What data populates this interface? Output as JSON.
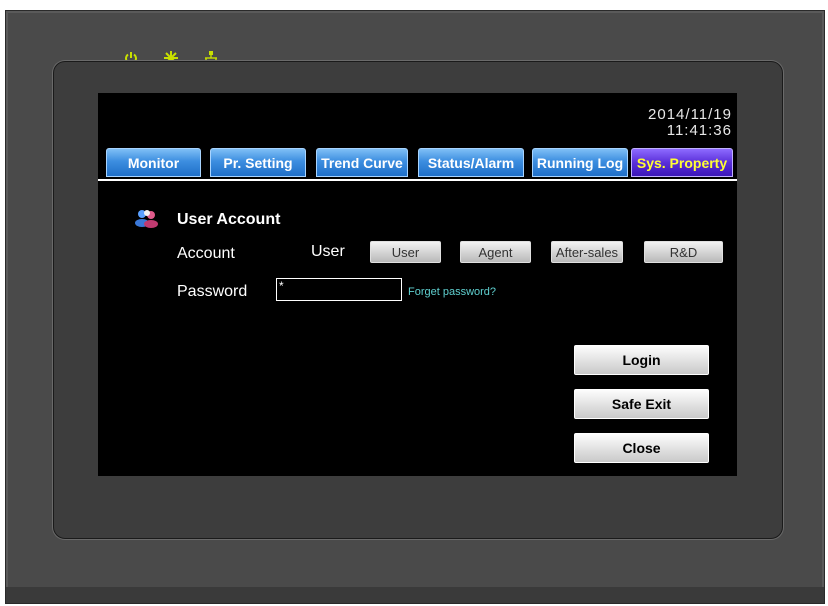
{
  "device": {
    "leds": [
      {
        "icon": "power-icon",
        "color": "#c8e000"
      },
      {
        "icon": "sun-icon",
        "color": "#c8e000"
      },
      {
        "icon": "network-icon",
        "color": "#c8e000"
      }
    ]
  },
  "screen": {
    "date": "2014/11/19",
    "time": "11:41:36"
  },
  "tabs": [
    {
      "label": "Monitor",
      "active": false
    },
    {
      "label": "Pr. Setting",
      "active": false
    },
    {
      "label": "Trend Curve",
      "active": false
    },
    {
      "label": "Status/Alarm",
      "active": false
    },
    {
      "label": "Running Log",
      "active": false
    },
    {
      "label": "Sys. Property",
      "active": true
    }
  ],
  "user_account": {
    "title": "User Account",
    "icon": "users-icon",
    "account_label": "Account",
    "current_user": "User",
    "roles": [
      "User",
      "Agent",
      "After-sales",
      "R&D"
    ],
    "password_label": "Password",
    "password_value": "*",
    "forget_password": "Forget password?"
  },
  "actions": {
    "login": "Login",
    "safe_exit": "Safe Exit",
    "close": "Close"
  },
  "colors": {
    "tab_blue": "#3d8ee0",
    "tab_active": "#5a2fd9",
    "tab_active_text": "#ffff33",
    "led": "#c8e000",
    "link": "#5fd0d0"
  }
}
